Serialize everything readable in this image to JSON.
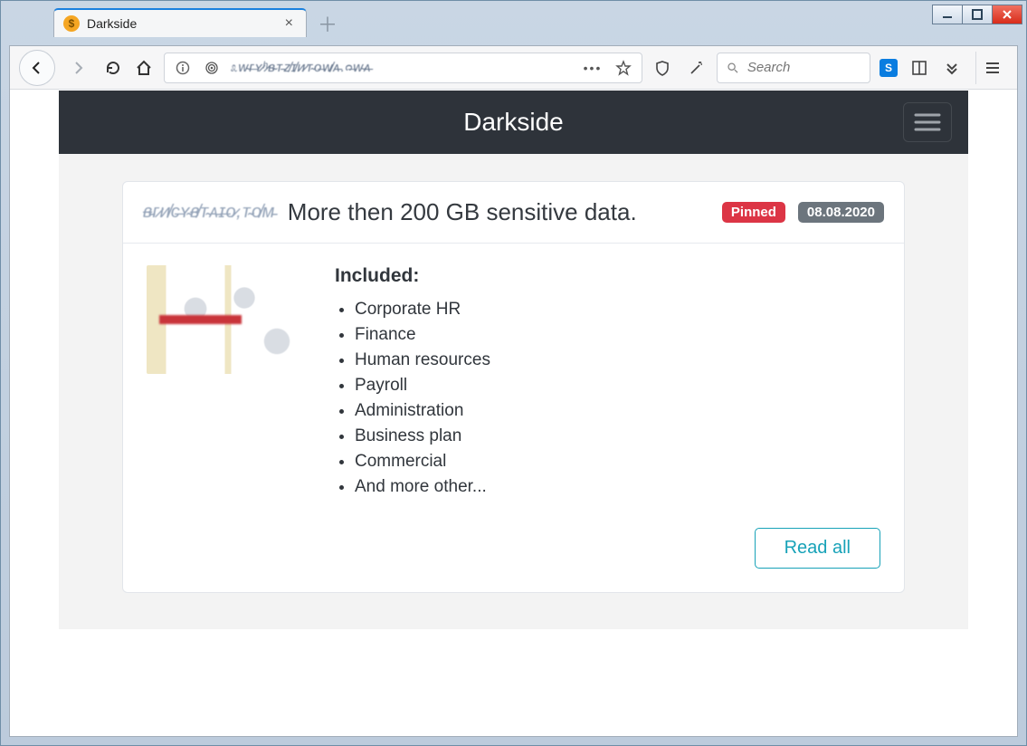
{
  "browser": {
    "tab_title": "Darkside",
    "url_obscured": "೩ᴡ̴ᴦ̶ʏ̷ʰ̷ʙ̴ᴛ̵ᴢ̸ɪ̸ᴎ̷ᴛ̴ᴏ̶ᴡ̸ᴀ̵.ᴒ̶ᴡ̴ᴀ̵",
    "search_placeholder": "Search"
  },
  "site": {
    "brand": "Darkside"
  },
  "post": {
    "source_obscured": "ᴃ̵ᴦ̷ᴎ̸ᴄ̶ʏ̴ᴃ̸ᴛ̴ᴀ̵ɪ̶ᴏ̷,ᴛ̴ᴏ̸ᴍ̵",
    "title": "More then 200 GB sensitive data.",
    "badges": {
      "pinned": "Pinned",
      "date": "08.08.2020"
    },
    "included_heading": "Included:",
    "included_items": [
      "Corporate HR",
      "Finance",
      "Human resources",
      "Payroll",
      "Administration",
      "Business plan",
      "Commercial",
      "And more other..."
    ],
    "read_all_label": "Read all"
  }
}
